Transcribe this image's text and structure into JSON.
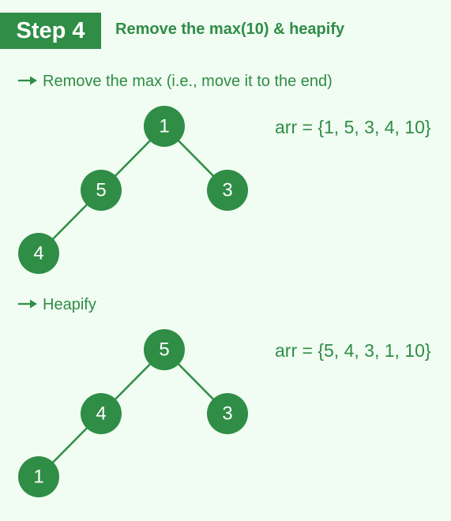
{
  "header": {
    "step_label": "Step 4",
    "title": "Remove the max(10) & heapify"
  },
  "colors": {
    "accent": "#2f8d46",
    "background": "#f1fcf2",
    "node_text": "#ffffff"
  },
  "sections": [
    {
      "label": "Remove the max (i.e., move it to the end)",
      "arr_text": "arr = {1, 5, 3, 4, 10}",
      "tree": {
        "nodes": [
          "1",
          "5",
          "3",
          "4"
        ],
        "edges": [
          [
            0,
            1
          ],
          [
            0,
            2
          ],
          [
            1,
            3
          ]
        ]
      }
    },
    {
      "label": "Heapify",
      "arr_text": "arr = {5, 4, 3, 1, 10}",
      "tree": {
        "nodes": [
          "5",
          "4",
          "3",
          "1"
        ],
        "edges": [
          [
            0,
            1
          ],
          [
            0,
            2
          ],
          [
            1,
            3
          ]
        ]
      }
    }
  ],
  "icons": {
    "section_marker": "arrow-right-icon"
  }
}
